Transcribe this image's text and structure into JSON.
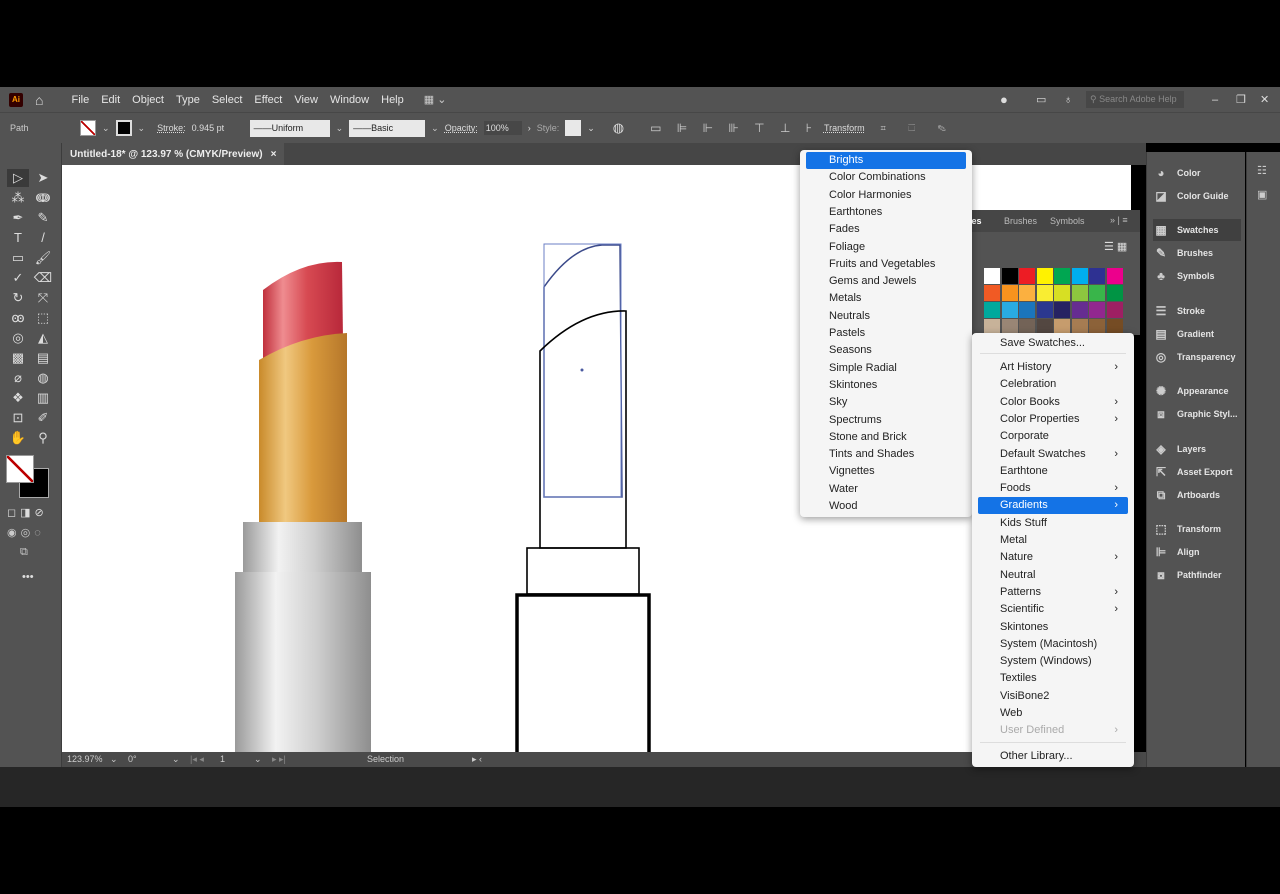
{
  "app": {
    "logo": "Ai",
    "menus": [
      "File",
      "Edit",
      "Object",
      "Type",
      "Select",
      "Effect",
      "View",
      "Window",
      "Help"
    ],
    "search_placeholder": "Search Adobe Help"
  },
  "control": {
    "selection_type": "Path",
    "stroke_label": "Stroke:",
    "stroke_weight": "0.945 pt",
    "profile": "Uniform",
    "brush": "Basic",
    "opacity_label": "Opacity:",
    "opacity": "100%",
    "style_label": "Style:",
    "transform_label": "Transform"
  },
  "document": {
    "tab_title": "Untitled-18* @ 123.97 % (CMYK/Preview)",
    "close": "×"
  },
  "status": {
    "zoom": "123.97%",
    "rotation": "0°",
    "artboard": "1",
    "tool": "Selection"
  },
  "swatches_panel": {
    "tabs": [
      "Swatches",
      "Brushes",
      "Symbols"
    ],
    "colors": [
      [
        "#ffffff",
        "#000000",
        "#ed1c24",
        "#fff200",
        "#00a651",
        "#00aeef",
        "#2e3192",
        "#ec008c"
      ],
      [
        "#f15a24",
        "#f7931e",
        "#fbb040",
        "#f9ed32",
        "#d7df23",
        "#8dc63f",
        "#39b54a",
        "#009444"
      ],
      [
        "#00a99d",
        "#29abe2",
        "#1b75bc",
        "#2b388f",
        "#262262",
        "#662d91",
        "#92278f",
        "#9e1f63"
      ],
      [
        "#c7b299",
        "#998675",
        "#736357",
        "#534741",
        "#c69c6d",
        "#a67c52",
        "#8c6239",
        "#754c24"
      ]
    ]
  },
  "dock": {
    "items": [
      "Color",
      "Color Guide",
      "Swatches",
      "Brushes",
      "Symbols",
      "Stroke",
      "Gradient",
      "Transparency",
      "Appearance",
      "Graphic Styl...",
      "Layers",
      "Asset Export",
      "Artboards",
      "Transform",
      "Align",
      "Pathfinder"
    ],
    "active": "Swatches"
  },
  "library_menu": {
    "items": [
      {
        "label": "Save Swatches..."
      },
      {
        "label": "Art History",
        "sub": true
      },
      {
        "label": "Celebration"
      },
      {
        "label": "Color Books",
        "sub": true
      },
      {
        "label": "Color Properties",
        "sub": true
      },
      {
        "label": "Corporate"
      },
      {
        "label": "Default Swatches",
        "sub": true
      },
      {
        "label": "Earthtone"
      },
      {
        "label": "Foods",
        "sub": true
      },
      {
        "label": "Gradients",
        "sub": true,
        "highlighted": true
      },
      {
        "label": "Kids Stuff"
      },
      {
        "label": "Metal"
      },
      {
        "label": "Nature",
        "sub": true
      },
      {
        "label": "Neutral"
      },
      {
        "label": "Patterns",
        "sub": true
      },
      {
        "label": "Scientific",
        "sub": true
      },
      {
        "label": "Skintones"
      },
      {
        "label": "System (Macintosh)"
      },
      {
        "label": "System (Windows)"
      },
      {
        "label": "Textiles"
      },
      {
        "label": "VisiBone2"
      },
      {
        "label": "Web"
      },
      {
        "label": "User Defined",
        "sub": true,
        "disabled": true
      },
      {
        "label": "Other Library..."
      }
    ]
  },
  "gradients_submenu": {
    "items": [
      "Brights",
      "Color Combinations",
      "Color Harmonies",
      "Earthtones",
      "Fades",
      "Foliage",
      "Fruits and Vegetables",
      "Gems and Jewels",
      "Metals",
      "Neutrals",
      "Pastels",
      "Seasons",
      "Simple Radial",
      "Skintones",
      "Sky",
      "Spectrums",
      "Stone and Brick",
      "Tints and Shades",
      "Vignettes",
      "Water",
      "Wood"
    ],
    "highlighted": "Brights"
  },
  "colors": {
    "accent": "#1473e6",
    "ui_bg": "#535353",
    "selection": "#4a5a9a"
  }
}
